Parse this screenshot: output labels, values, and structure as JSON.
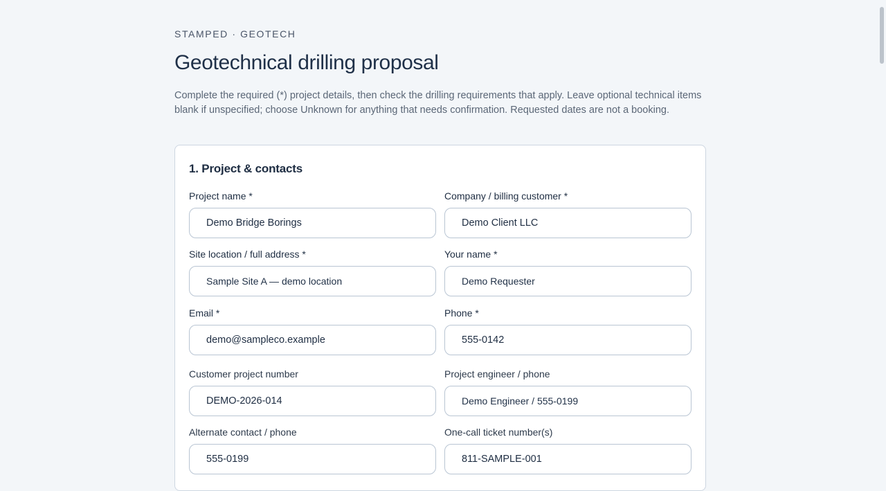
{
  "header": {
    "eyebrow": "STAMPED · GEOTECH",
    "title": "Geotechnical drilling proposal",
    "intro": "Complete the required (*) project details, then check the drilling requirements that apply. Leave optional technical items blank if unspecified; choose Unknown for anything that needs confirmation. Requested dates are not a booking."
  },
  "section1": {
    "title": "1. Project & contacts",
    "fields": {
      "project_name": {
        "label": "Project name *",
        "value": "Demo Bridge Borings"
      },
      "company": {
        "label": "Company / billing customer *",
        "value": "Demo Client LLC"
      },
      "site_location": {
        "label": "Site location / full address *",
        "value": "Sample Site A — demo location"
      },
      "your_name": {
        "label": "Your name *",
        "value": "Demo Requester"
      },
      "email": {
        "label": "Email *",
        "value": "demo@sampleco.example"
      },
      "phone": {
        "label": "Phone *",
        "value": "555-0142"
      },
      "customer_project_number": {
        "label": "Customer project number",
        "value": "DEMO-2026-014"
      },
      "project_engineer": {
        "label": "Project engineer / phone",
        "value": "Demo Engineer / 555-0199"
      },
      "alternate_contact": {
        "label": "Alternate contact / phone",
        "value": "555-0199"
      },
      "one_call_ticket": {
        "label": "One-call ticket number(s)",
        "value": "811-SAMPLE-001"
      }
    }
  }
}
